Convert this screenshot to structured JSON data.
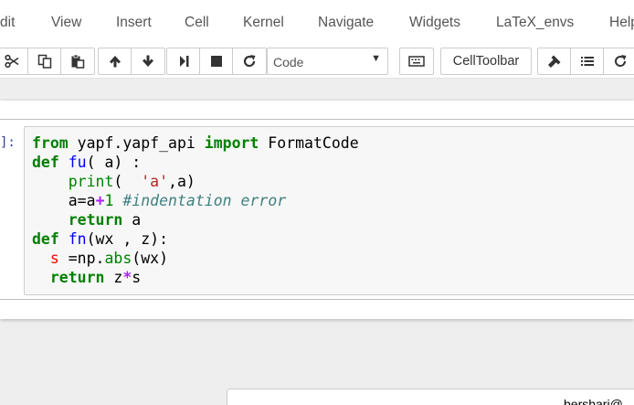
{
  "menu": {
    "items": [
      {
        "name": "menu-edit",
        "label": "dit"
      },
      {
        "name": "menu-view",
        "label": "View"
      },
      {
        "name": "menu-insert",
        "label": "Insert"
      },
      {
        "name": "menu-cell",
        "label": "Cell"
      },
      {
        "name": "menu-kernel",
        "label": "Kernel"
      },
      {
        "name": "menu-navigate",
        "label": "Navigate"
      },
      {
        "name": "menu-widgets",
        "label": "Widgets"
      },
      {
        "name": "menu-latex-envs",
        "label": "LaTeX_envs"
      },
      {
        "name": "menu-help",
        "label": "Help"
      }
    ]
  },
  "toolbar": {
    "cell_type": "Code",
    "celltoolbar_label": "CellToolbar",
    "icons": [
      "cut-icon",
      "copy-icon",
      "paste-icon",
      "move-up-icon",
      "move-down-icon",
      "run-icon",
      "stop-icon",
      "restart-icon",
      "keyboard-icon",
      "hammer-icon",
      "list-icon",
      "refresh-icon"
    ]
  },
  "cell": {
    "prompt": "]:",
    "code_lines": [
      "from yapf.yapf_api import FormatCode",
      "def fu( a) :",
      "    print(  'a',a)",
      "    a=a+1 #indentation error",
      "    return a",
      "def fn(wx , z):",
      "  s =np.abs(wx)",
      "  return z*s"
    ],
    "tokens": {
      "from": "from",
      "mod": " yapf.yapf_api ",
      "import": "import",
      "name": " FormatCode",
      "def": "def",
      "fu": "fu",
      "fu_args": "( a) :",
      "print": "print",
      "print_open": "(  ",
      "str_a": "'a'",
      "print_close": ",a)",
      "assign": "a=a",
      "plus": "+",
      "one": "1",
      "comment": "#indentation error",
      "return": "return",
      "ret_a": " a",
      "fn": "fn",
      "fn_args": "(wx , z):",
      "s": "s",
      "np": " =np.",
      "abs": "abs",
      "abs_args": "(wx)",
      "z": " z",
      "star": "*",
      "s2": "s"
    }
  },
  "popup": {
    "text": "bershari@"
  }
}
